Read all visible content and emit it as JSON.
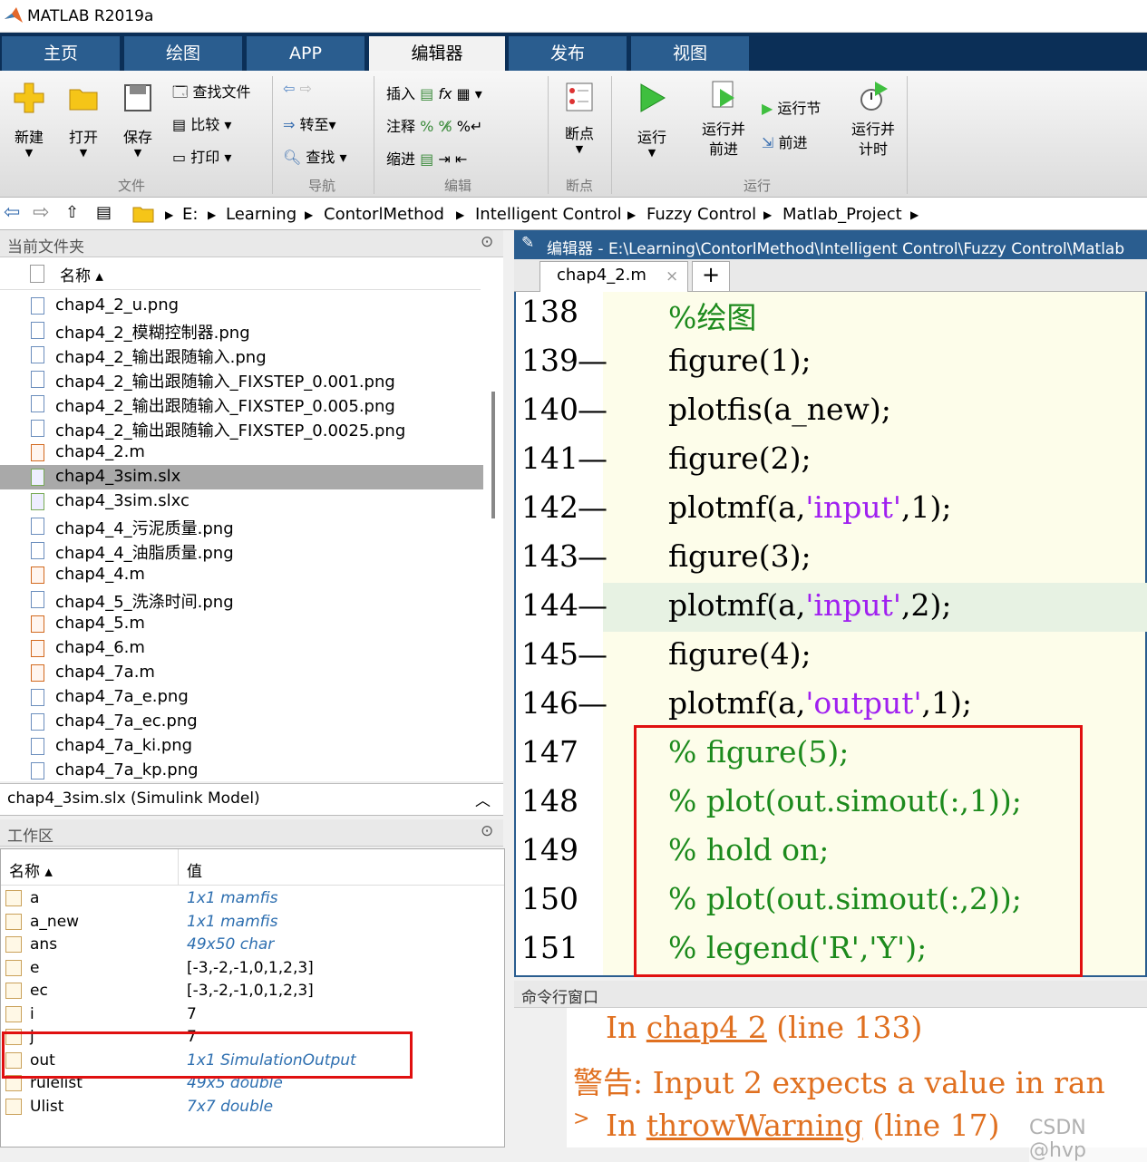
{
  "window": {
    "title": "MATLAB R2019a"
  },
  "tabs": [
    "主页",
    "绘图",
    "APP",
    "编辑器",
    "发布",
    "视图"
  ],
  "ribbon": {
    "new": "新建",
    "open": "打开",
    "save": "保存",
    "find_files": "查找文件",
    "compare": "比较",
    "print": "打印",
    "goto": "转至",
    "find": "查找",
    "insert": "插入",
    "comment": "注释",
    "indent": "缩进",
    "fx": "fx",
    "breakpoints": "断点",
    "run": "运行",
    "run_advance": "运行并\n前进",
    "run_section": "运行节",
    "advance": "前进",
    "run_time": "运行并\n计时",
    "groups": [
      "文件",
      "导航",
      "编辑",
      "断点",
      "运行"
    ]
  },
  "address": {
    "crumbs": [
      "E:",
      "Learning",
      "ContorlMethod",
      "Intelligent Control",
      "Fuzzy Control",
      "Matlab_Project"
    ]
  },
  "current_folder": {
    "header": "当前文件夹",
    "col_name": "名称 ▴",
    "files": [
      {
        "name": "chap4_2_u.png",
        "type": "png"
      },
      {
        "name": "chap4_2_模糊控制器.png",
        "type": "png"
      },
      {
        "name": "chap4_2_输出跟随输入.png",
        "type": "png"
      },
      {
        "name": "chap4_2_输出跟随输入_FIXSTEP_0.001.png",
        "type": "png"
      },
      {
        "name": "chap4_2_输出跟随输入_FIXSTEP_0.005.png",
        "type": "png"
      },
      {
        "name": "chap4_2_输出跟随输入_FIXSTEP_0.0025.png",
        "type": "png"
      },
      {
        "name": "chap4_2.m",
        "type": "m"
      },
      {
        "name": "chap4_3sim.slx",
        "type": "slx",
        "selected": true
      },
      {
        "name": "chap4_3sim.slxc",
        "type": "slxc"
      },
      {
        "name": "chap4_4_污泥质量.png",
        "type": "png"
      },
      {
        "name": "chap4_4_油脂质量.png",
        "type": "png"
      },
      {
        "name": "chap4_4.m",
        "type": "m"
      },
      {
        "name": "chap4_5_洗涤时间.png",
        "type": "png"
      },
      {
        "name": "chap4_5.m",
        "type": "m"
      },
      {
        "name": "chap4_6.m",
        "type": "m"
      },
      {
        "name": "chap4_7a.m",
        "type": "m"
      },
      {
        "name": "chap4_7a_e.png",
        "type": "png"
      },
      {
        "name": "chap4_7a_ec.png",
        "type": "png"
      },
      {
        "name": "chap4_7a_ki.png",
        "type": "png"
      },
      {
        "name": "chap4_7a_kp.png",
        "type": "png"
      }
    ],
    "detail": "chap4_3sim.slx  (Simulink Model)"
  },
  "workspace": {
    "header": "工作区",
    "col_name": "名称 ▴",
    "col_value": "值",
    "vars": [
      {
        "name": "a",
        "value": "1x1 mamfis",
        "italic": true
      },
      {
        "name": "a_new",
        "value": "1x1 mamfis",
        "italic": true
      },
      {
        "name": "ans",
        "value": "49x50 char",
        "italic": true
      },
      {
        "name": "e",
        "value": "[-3,-2,-1,0,1,2,3]",
        "italic": false
      },
      {
        "name": "ec",
        "value": "[-3,-2,-1,0,1,2,3]",
        "italic": false
      },
      {
        "name": "i",
        "value": "7",
        "italic": false
      },
      {
        "name": "j",
        "value": "7",
        "italic": false
      },
      {
        "name": "out",
        "value": "1x1 SimulationOutput",
        "italic": true
      },
      {
        "name": "rulelist",
        "value": "49x5 double",
        "italic": true
      },
      {
        "name": "Ulist",
        "value": "7x7 double",
        "italic": true
      }
    ]
  },
  "editor": {
    "header": "编辑器 - E:\\Learning\\ContorlMethod\\Intelligent Control\\Fuzzy Control\\Matlab",
    "tab": "chap4_2.m",
    "close": "×",
    "plus": "+",
    "lines": [
      {
        "no": "138",
        "dash": "",
        "code": "%绘图",
        "kind": "comment"
      },
      {
        "no": "139",
        "dash": "—",
        "code": "figure(1);",
        "kind": "code"
      },
      {
        "no": "140",
        "dash": "—",
        "code": "plotfis(a_new);",
        "kind": "code"
      },
      {
        "no": "141",
        "dash": "—",
        "code": "figure(2);",
        "kind": "code"
      },
      {
        "no": "142",
        "dash": "—",
        "code": "plotmf(a,'input',1);",
        "kind": "str",
        "pre": "plotmf(a,",
        "s": "'input'",
        "post": ",1);"
      },
      {
        "no": "143",
        "dash": "—",
        "code": "figure(3);",
        "kind": "code"
      },
      {
        "no": "144",
        "dash": "—",
        "code": "plotmf(a,'input',2);",
        "kind": "str",
        "pre": "plotmf(a,",
        "s": "'input'",
        "post": ",2);"
      },
      {
        "no": "145",
        "dash": "—",
        "code": "figure(4);",
        "kind": "code"
      },
      {
        "no": "146",
        "dash": "—",
        "code": "plotmf(a,'output',1);",
        "kind": "str",
        "pre": "plotmf(a,",
        "s": "'output'",
        "post": ",1);"
      },
      {
        "no": "147",
        "dash": "",
        "code": "% figure(5);",
        "kind": "comment"
      },
      {
        "no": "148",
        "dash": "",
        "code": "% plot(out.simout(:,1));",
        "kind": "comment"
      },
      {
        "no": "149",
        "dash": "",
        "code": "% hold on;",
        "kind": "comment"
      },
      {
        "no": "150",
        "dash": "",
        "code": "% plot(out.simout(:,2));",
        "kind": "comment"
      },
      {
        "no": "151",
        "dash": "",
        "code": "% legend('R','Y');",
        "kind": "comment"
      }
    ]
  },
  "command": {
    "header": "命令行窗口",
    "line1_pre": "In ",
    "line1_link": "chap4 2",
    "line1_post": " (line 133)",
    "line2": "警告: Input 2 expects a value in ran",
    "line3_pre": "In ",
    "line3_link": "throwWarning",
    "line3_post": " (line 17)"
  },
  "watermark": "CSDN @hvp",
  "colors": {
    "accent": "#2a5d8f",
    "comment": "#1c8a1c",
    "string": "#a020f0",
    "warning": "#e07020",
    "highlight": "#e01010"
  }
}
